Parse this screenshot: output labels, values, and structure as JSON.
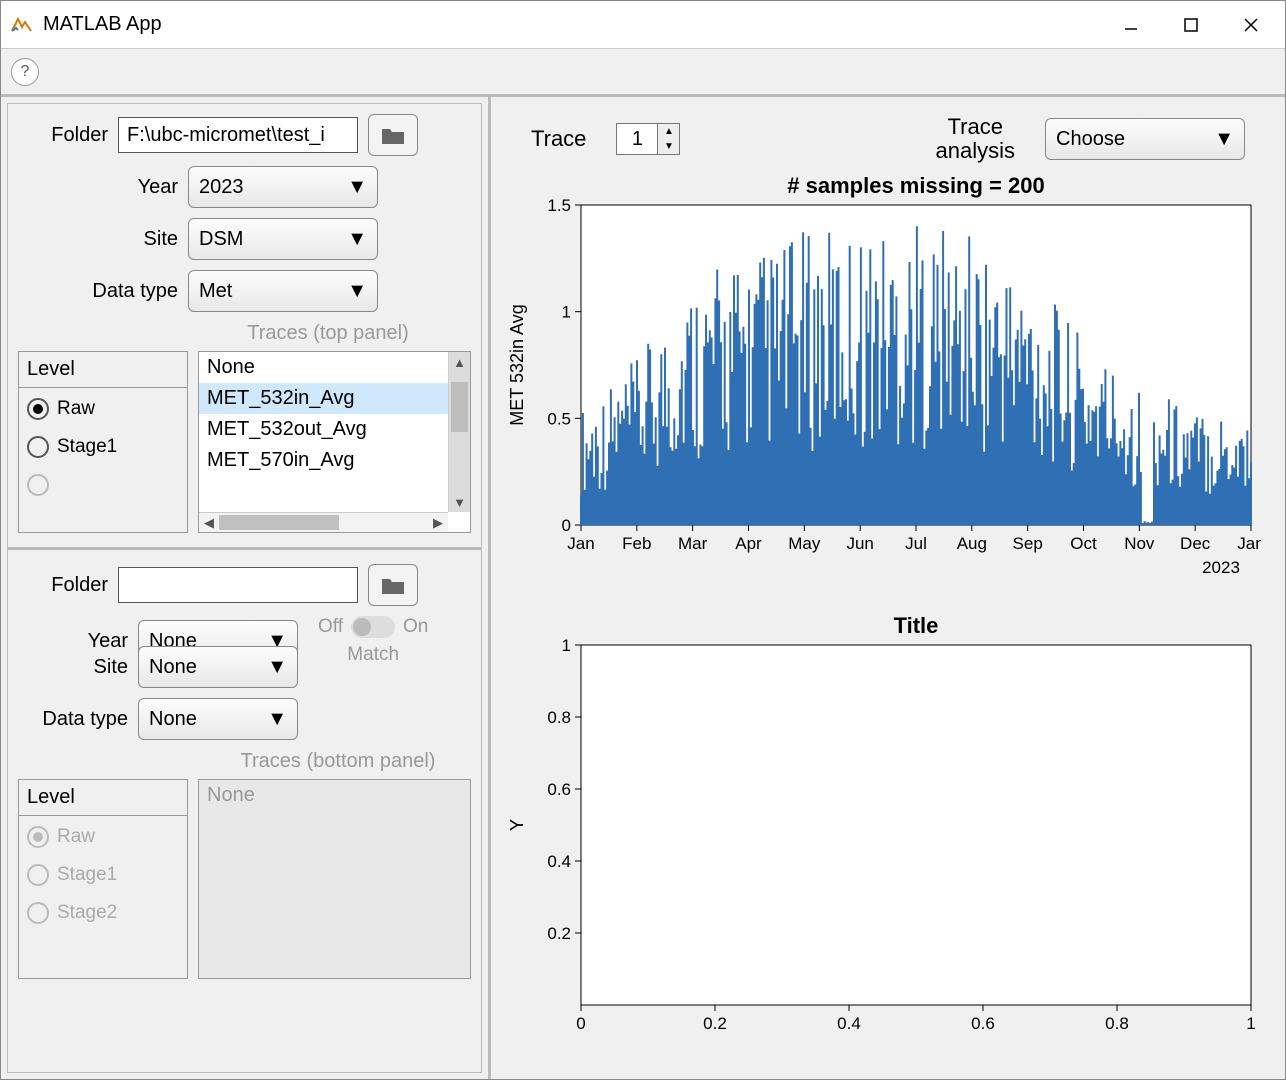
{
  "window": {
    "title": "MATLAB App"
  },
  "top_panel": {
    "folder_label": "Folder",
    "folder_value": "F:\\ubc-micromet\\test_i",
    "year_label": "Year",
    "year_value": "2023",
    "site_label": "Site",
    "site_value": "DSM",
    "dtype_label": "Data type",
    "dtype_value": "Met",
    "traces_label": "Traces (top panel)",
    "level_label": "Level",
    "level_options": [
      "Raw",
      "Stage1"
    ],
    "level_selected": "Raw",
    "trace_list": [
      "None",
      "MET_532in_Avg",
      "MET_532out_Avg",
      "MET_570in_Avg"
    ],
    "trace_selected_index": 1
  },
  "bottom_panel": {
    "folder_label": "Folder",
    "folder_value": "",
    "year_label": "Year",
    "year_value": "None",
    "site_label": "Site",
    "site_value": "None",
    "dtype_label": "Data type",
    "dtype_value": "None",
    "toggle_off": "Off",
    "toggle_on": "On",
    "match_label": "Match",
    "traces_label": "Traces (bottom  panel)",
    "level_label": "Level",
    "level_options": [
      "Raw",
      "Stage1",
      "Stage2"
    ],
    "trace_list": [
      "None"
    ]
  },
  "right_header": {
    "trace_label": "Trace",
    "trace_value": "1",
    "analysis_label_l1": "Trace",
    "analysis_label_l2": "analysis",
    "analysis_value": "Choose"
  },
  "chart_data": [
    {
      "type": "bar",
      "title": "# samples missing = 200",
      "ylabel": "MET 532in Avg",
      "xlabel": "",
      "ylim": [
        0,
        1.5
      ],
      "yticks": [
        0,
        0.5,
        1,
        1.5
      ],
      "xticks": [
        "Jan",
        "Feb",
        "Mar",
        "Apr",
        "May",
        "Jun",
        "Jul",
        "Aug",
        "Sep",
        "Oct",
        "Nov",
        "Dec",
        "Jan"
      ],
      "sub_xlabel": "2023",
      "monthly_envelope_max": [
        0.55,
        0.78,
        1.18,
        1.28,
        1.38,
        1.4,
        1.43,
        1.38,
        1.2,
        0.88,
        0.68,
        0.55
      ],
      "notes": "Dense bar/time-series; values are approximate monthly maxima read from the chart. A visible gap occurs around early November."
    },
    {
      "type": "line",
      "title": "Title",
      "ylabel": "Y",
      "xlabel": "",
      "xlim": [
        0,
        1
      ],
      "ylim": [
        0,
        1
      ],
      "xticks": [
        0,
        0.2,
        0.4,
        0.6,
        0.8,
        1
      ],
      "yticks": [
        0.2,
        0.4,
        0.6,
        0.8,
        1
      ],
      "series": []
    }
  ]
}
